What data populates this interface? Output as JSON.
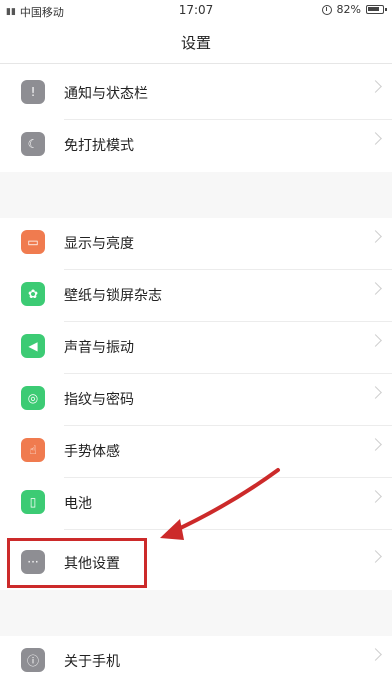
{
  "status_bar": {
    "carrier": "中国移动",
    "time": "17:07",
    "battery": "82%",
    "signal_icon": "signal-icon",
    "alarm_icon": "alarm-icon",
    "battery_icon": "battery-icon"
  },
  "header": {
    "title": "设置"
  },
  "settings": {
    "items": [
      {
        "label": "通知与状态栏",
        "icon": "notification-icon",
        "color": "#8e8e93"
      },
      {
        "label": "免打扰模式",
        "icon": "moon-icon",
        "color": "#8e8e93"
      },
      {
        "label": "显示与亮度",
        "icon": "display-icon",
        "color": "#f07b4f"
      },
      {
        "label": "壁纸与锁屏杂志",
        "icon": "wallpaper-icon",
        "color": "#3ccb74"
      },
      {
        "label": "声音与振动",
        "icon": "sound-icon",
        "color": "#3ccb74"
      },
      {
        "label": "指纹与密码",
        "icon": "fingerprint-icon",
        "color": "#3ccb74"
      },
      {
        "label": "手势体感",
        "icon": "gesture-icon",
        "color": "#f07b4f"
      },
      {
        "label": "电池",
        "icon": "battery-icon",
        "color": "#3ccb74"
      },
      {
        "label": "其他设置",
        "icon": "more-icon",
        "color": "#8e8e93"
      },
      {
        "label": "关于手机",
        "icon": "info-icon",
        "color": "#8e8e93"
      }
    ]
  },
  "annotation": {
    "color": "#cc2a2a",
    "highlighted_item": "其他设置"
  }
}
